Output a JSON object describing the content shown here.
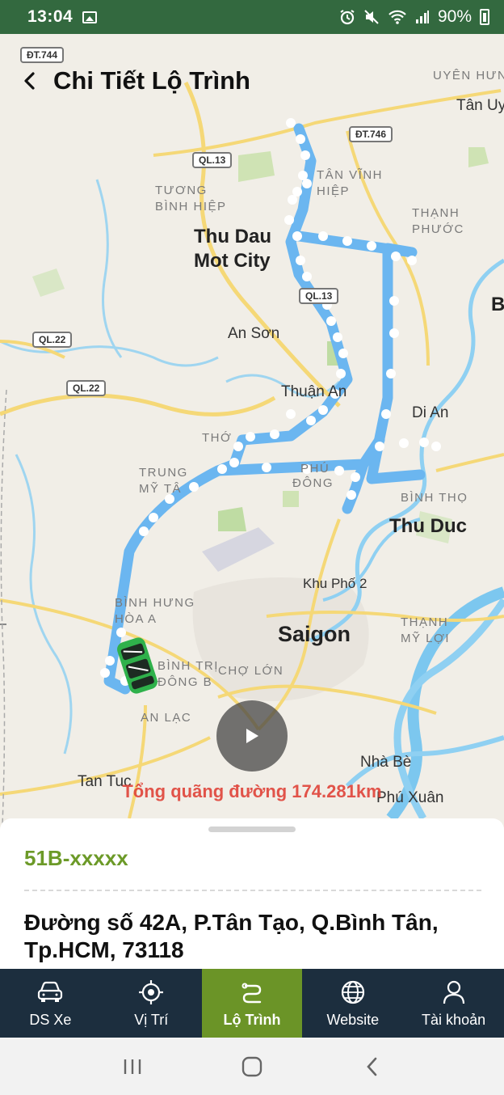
{
  "status_bar": {
    "time": "13:04",
    "battery": "90%",
    "icons": [
      "gallery-icon",
      "alarm-icon",
      "mute-icon",
      "wifi-icon",
      "signal-icon",
      "battery-icon"
    ]
  },
  "header": {
    "title": "Chi Tiết Lộ Trình",
    "back_icon": "back-arrow-icon"
  },
  "map": {
    "labels": {
      "uyen_hung": "UYÊN HƯN",
      "tan_uyen": "Tân Uy",
      "tan_vinh_hiep": "TÂN VĨNH\nHIỆP",
      "tuong_binh_hiep": "TƯƠNG\nBÌNH HIỆP",
      "thanh_phuoc": "THẠNH\nPHƯỚC",
      "thu_dau_mot": "Thu Dau\nMot City",
      "an_son": "An Sơn",
      "thuan_an": "Thuận An",
      "di_an": "Di An",
      "tho": "THỚ",
      "trung_my_tay": "TRUNG\nMỸ TÂ",
      "binh_tho": "BÌNH THỌ",
      "thu_duc": "Thu Duc",
      "khu_pho_2": "Khu Phố 2",
      "binh_hung_hoa": "BÌNH HƯNG\nHÒA A",
      "thanh_my_loi": "THẠNH\nMỸ LỢI",
      "saigon": "Saigon",
      "binh_tri_dong": "BÌNH TRỊ\nĐÔNG B",
      "cho_lon": "CHỢ LỚN",
      "an_lac": "AN LẠC",
      "nha_be": "Nhà Bè",
      "tan_tuc": "Tan Tuc",
      "phu_xuan": "Phú Xuân",
      "b_edge": "B",
      "dong": "ĐÔNG",
      "phu": "PHÚ"
    },
    "road_shields": [
      "ĐT.744",
      "ĐT.746",
      "QL.13",
      "QL.22",
      "QL.22",
      "QL.13"
    ],
    "distance_label": "Tổng quãng đường 174.281km",
    "route_color": "#6bb6f0"
  },
  "vehicle": {
    "plate": "51B-xxxxx",
    "address": "Đường số 42A, P.Tân Tạo, Q.Bình Tân, Tp.HCM, 73118"
  },
  "bottom_nav": {
    "items": [
      {
        "label": "DS Xe",
        "icon": "car-icon"
      },
      {
        "label": "Vị Trí",
        "icon": "crosshair-icon"
      },
      {
        "label": "Lộ Trình",
        "icon": "route-icon"
      },
      {
        "label": "Website",
        "icon": "globe-icon"
      },
      {
        "label": "Tài khoản",
        "icon": "user-icon"
      }
    ],
    "active_index": 2
  },
  "colors": {
    "status_bar": "#33693f",
    "nav_background": "#1c2e3e",
    "nav_active": "#6b9427",
    "plate_text": "#6c9a28",
    "distance_text": "#e0463c"
  }
}
